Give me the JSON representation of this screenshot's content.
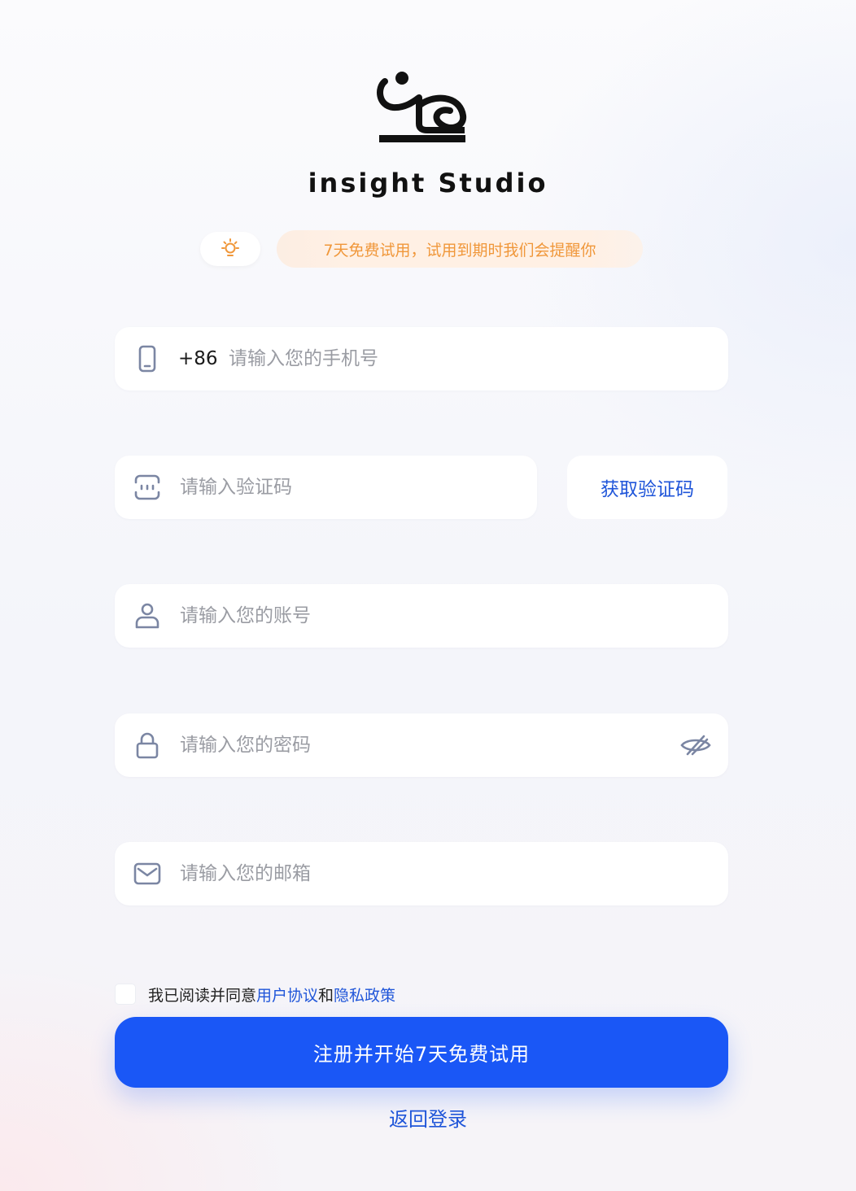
{
  "brand": {
    "name": "insight Studio"
  },
  "tip": {
    "text": "7天免费试用，试用到期时我们会提醒你",
    "icon": "lightbulb-icon",
    "color": "#f0973a"
  },
  "form": {
    "phone": {
      "prefix": "+86",
      "placeholder": "请输入您的手机号",
      "value": "",
      "icon": "phone-icon"
    },
    "code": {
      "placeholder": "请输入验证码",
      "value": "",
      "icon": "captcha-icon",
      "button_label": "获取验证码"
    },
    "account": {
      "placeholder": "请输入您的账号",
      "value": "",
      "icon": "user-icon"
    },
    "password": {
      "placeholder": "请输入您的密码",
      "value": "",
      "icon": "lock-icon",
      "toggle_icon": "eye-hidden-icon"
    },
    "email": {
      "placeholder": "请输入您的邮箱",
      "value": "",
      "icon": "mail-icon"
    }
  },
  "agreement": {
    "checked": false,
    "prefix": "我已阅读并同意 ",
    "terms_link": "用户协议",
    "joiner": "和 ",
    "privacy_link": "隐私政策"
  },
  "actions": {
    "submit_label": "注册并开始7天免费试用",
    "back_label": "返回登录"
  },
  "colors": {
    "primary": "#1a57f6",
    "link": "#1f55d9",
    "placeholder": "#9a9ca3"
  }
}
